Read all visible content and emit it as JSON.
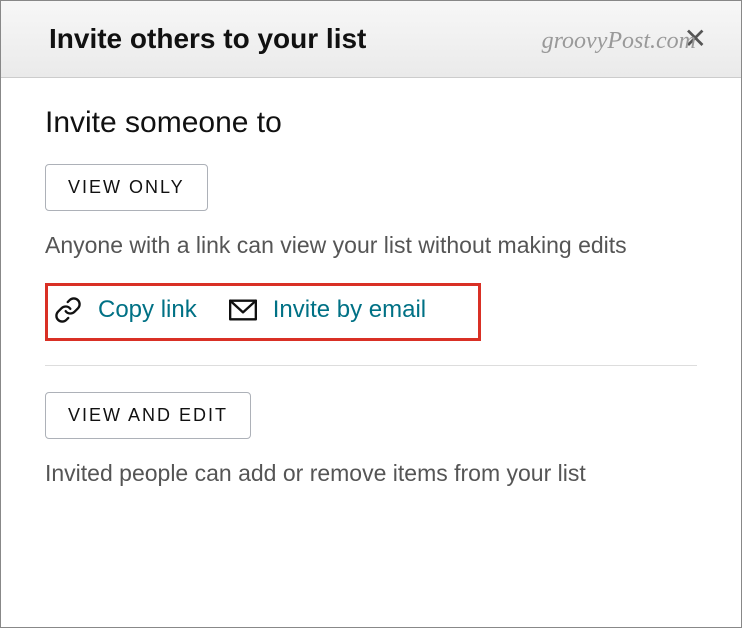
{
  "header": {
    "title": "Invite others to your list"
  },
  "watermark": "groovyPost.com",
  "subtitle": "Invite someone to",
  "viewOnly": {
    "buttonLabel": "VIEW ONLY",
    "description": "Anyone with a link can view your list without making edits",
    "copyLinkLabel": "Copy link",
    "inviteEmailLabel": "Invite by email"
  },
  "viewEdit": {
    "buttonLabel": "VIEW AND EDIT",
    "description": "Invited people can add or remove items from your list"
  }
}
